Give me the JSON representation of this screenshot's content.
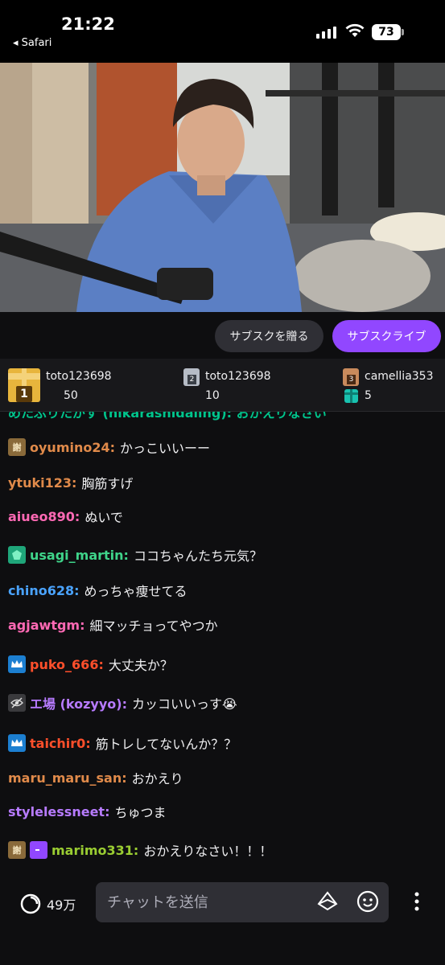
{
  "status": {
    "time": "21:22",
    "back_app": "◂ Safari",
    "battery": "73"
  },
  "subs": {
    "gift_label": "サブスクを贈る",
    "subscribe_label": "サブスクライブ"
  },
  "leaderboard": [
    {
      "rank": "1",
      "name": "toto123698",
      "count": "50"
    },
    {
      "rank": "2",
      "name": "toto123698",
      "count": "10"
    },
    {
      "rank": "3",
      "name": "camellia353",
      "count": "5"
    }
  ],
  "chat": {
    "cut_line": "めたぷりたがす (hikarashidaling): おかえりなさい",
    "messages": [
      {
        "badges": [
          "thanks-badge"
        ],
        "user": "oyumino24:",
        "color": "#e08a4a",
        "text": "かっこいいーー"
      },
      {
        "badges": [],
        "user": "ytuki123:",
        "color": "#e08a4a",
        "text": "胸筋すげ"
      },
      {
        "badges": [],
        "user": "aiueo890:",
        "color": "#ff69b4",
        "text": "ぬいで"
      },
      {
        "badges": [
          "gem-badge"
        ],
        "user": "usagi_martin:",
        "color": "#3fd48a",
        "text": "ココちゃんたち元気？"
      },
      {
        "badges": [],
        "user": "chino628:",
        "color": "#4aa3ff",
        "text": "めっちゃ痩せてる"
      },
      {
        "badges": [],
        "user": "agjawtgm:",
        "color": "#ff69b4",
        "text": "細マッチョってやつか"
      },
      {
        "badges": [
          "crown-badge"
        ],
        "user": "puko_666:",
        "color": "#ff4f2b",
        "text": "大丈夫か？"
      },
      {
        "badges": [
          "hidden-badge"
        ],
        "user": "エ場 (kozyyo):",
        "color": "#b77bff",
        "text": "カッコいいっす😭"
      },
      {
        "badges": [
          "crown-badge"
        ],
        "user": "taichir0:",
        "color": "#ff4f2b",
        "text": "筋トレしてないんか？？"
      },
      {
        "badges": [],
        "user": "maru_maru_san:",
        "color": "#e08a4a",
        "text": "おかえり"
      },
      {
        "badges": [],
        "user": "stylelessneet:",
        "color": "#b77bff",
        "text": "ちゅつま"
      },
      {
        "badges": [
          "thanks-badge",
          "purple-emote-badge"
        ],
        "user": "marimo331:",
        "color": "#9acd32",
        "text": "おかえりなさい！！！"
      }
    ]
  },
  "bottom": {
    "points": "49万",
    "input_placeholder": "チャットを送信"
  },
  "colors": {
    "accent": "#9147ff",
    "background": "#0e0e10",
    "surface": "#2f2f35"
  }
}
